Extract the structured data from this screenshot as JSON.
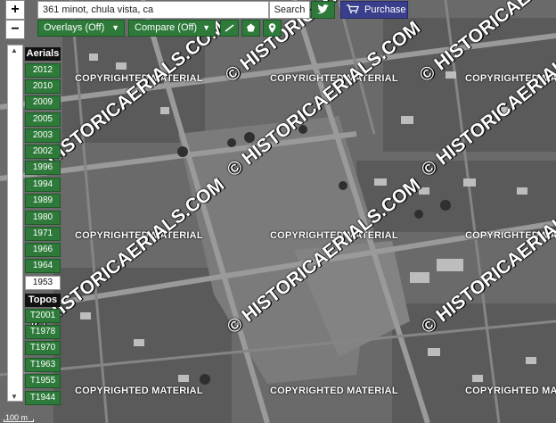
{
  "toolbar": {
    "zoom_in_label": "+",
    "zoom_out_label": "−",
    "search_value": "361 minot, chula vista, ca",
    "search_label": "Search",
    "twitter_icon": "twitter-bird-icon",
    "purchase_label": "Purchase",
    "purchase_icon": "cart-icon",
    "overlays_label": "Overlays (Off)",
    "compare_label": "Compare (Off)",
    "tools": [
      "line-tool-icon",
      "polygon-tool-icon",
      "marker-tool-icon"
    ]
  },
  "panel": {
    "aerials_header": "Aerials",
    "aerial_years": [
      "2012",
      "2010",
      "2009",
      "2005",
      "2003",
      "2002",
      "1996",
      "1994",
      "1989",
      "1980",
      "1971",
      "1966",
      "1964",
      "1953"
    ],
    "active_year": "1953",
    "topos_header": "Topos",
    "topo_years": [
      "T2001",
      "T1978",
      "T1970",
      "T1963",
      "T1955",
      "T1944"
    ]
  },
  "map": {
    "scale_label": "100 m",
    "watermark_copyright": "COPYRIGHTED MATERIAL",
    "watermark_site": "© HISTORICAERIALS.COM"
  },
  "colors": {
    "button_green": "#2d7a3a",
    "purchase_blue": "#3a3f8c",
    "header_black": "#111111"
  }
}
